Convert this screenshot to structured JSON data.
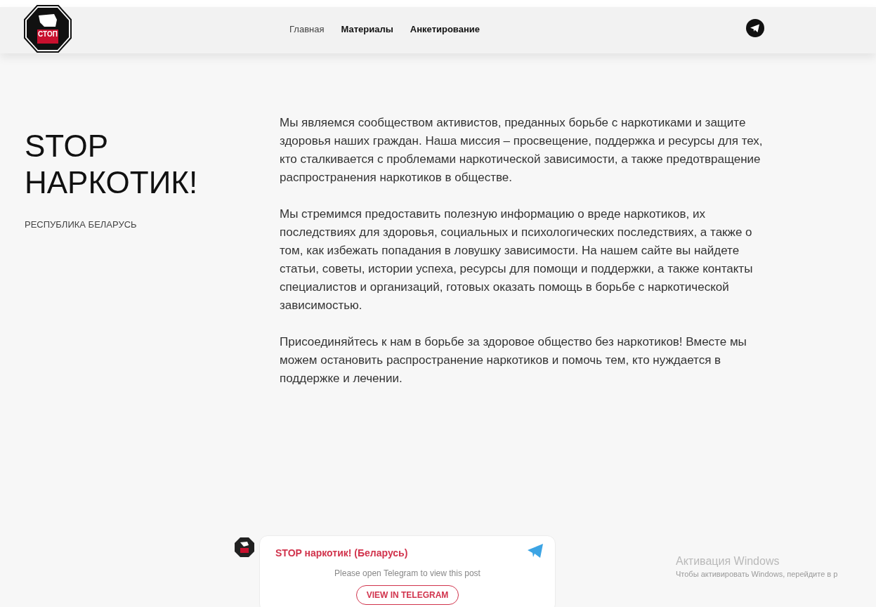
{
  "logo": {
    "text": "СТОП"
  },
  "nav": [
    {
      "label": "Главная",
      "selected": true
    },
    {
      "label": "Материалы",
      "selected": false
    },
    {
      "label": "Анкетирование",
      "selected": false
    }
  ],
  "hero": {
    "title": "STOP НАРКОТИК!",
    "subtitle": "РЕСПУБЛИКА БЕЛАРУСЬ",
    "paragraphs": [
      "Мы являемся сообществом активистов, преданных борьбе с наркотиками и защите здоровья наших граждан. Наша миссия – просвещение, поддержка и ресурсы для тех, кто сталкивается с проблемами наркотической зависимости, а также предотвращение распространения наркотиков в обществе.",
      "Мы стремимся предоставить полезную информацию о вреде наркотиков, их последствиях для здоровья, социальных и психологических последствиях, а также о том, как избежать попадания в ловушку зависимости. На нашем сайте вы найдете статьи, советы, истории успеха, ресурсы для помощи и поддержки, а также контакты специалистов и организаций, готовых оказать помощь в борьбе с наркотической зависимостью.",
      "Присоединяйтесь к нам в борьбе за здоровое общество без наркотиков! Вместе мы можем остановить распространение наркотиков и помочь тем, кто нуждается в поддержке и лечении."
    ]
  },
  "telegram_post": {
    "channel": "STOP наркотик! (Беларусь)",
    "message": "Please open Telegram to view this post",
    "button": "VIEW IN TELEGRAM"
  },
  "os_notice": {
    "title": "Активация Windows",
    "text": "Чтобы активировать Windows, перейдите в р"
  }
}
